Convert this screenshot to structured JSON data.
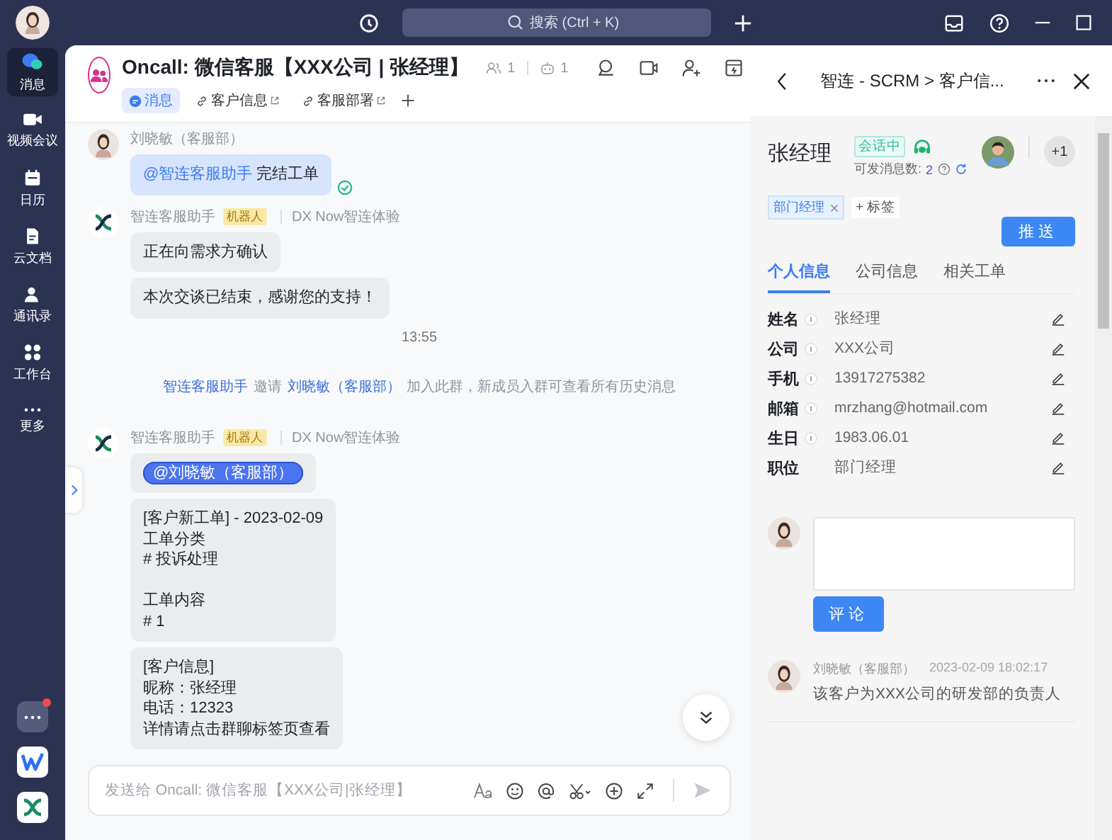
{
  "top_bar": {
    "search": {
      "placeholder": "搜索 (Ctrl + K)"
    }
  },
  "sidebar": {
    "items": [
      {
        "label": "消息",
        "kind": "chat",
        "selected": true
      },
      {
        "label": "视频会议",
        "kind": "video",
        "selected": false
      },
      {
        "label": "日历",
        "kind": "calendar",
        "selected": false
      },
      {
        "label": "云文档",
        "kind": "docs",
        "selected": false
      },
      {
        "label": "通讯录",
        "kind": "contacts",
        "selected": false
      },
      {
        "label": "工作台",
        "kind": "apps",
        "selected": false
      },
      {
        "label": "更多",
        "kind": "more",
        "selected": false
      }
    ]
  },
  "chat": {
    "title": "Oncall: 微信客服【XXX公司 | 张经理】",
    "member_count": "1",
    "bot_count": "1",
    "tabs": [
      {
        "label": "消息",
        "kind": "messages",
        "selected": true
      },
      {
        "label": "客户信息",
        "kind": "link",
        "selected": false
      },
      {
        "label": "客服部署",
        "kind": "link",
        "selected": false
      }
    ],
    "messages": [
      {
        "kind": "user",
        "sender": "刘晓敏（客服部）",
        "bubbles": [
          {
            "kind": "mention_text",
            "mention": "@智连客服助手",
            "text": "完结工单"
          }
        ]
      },
      {
        "kind": "bot",
        "sender": "智连客服助手",
        "badge": "机器人",
        "org": "DX Now智连体验",
        "bubbles": [
          {
            "kind": "text",
            "paragraphs": [
              [
                "正在向需求方确认"
              ]
            ]
          },
          {
            "kind": "text",
            "paragraphs": [
              [
                "本次交谈已结束，感谢您的支持！"
              ]
            ]
          }
        ]
      },
      {
        "kind": "time",
        "text": "13:55"
      },
      {
        "kind": "system",
        "parts": [
          {
            "text": "智连客服助手",
            "link": true
          },
          {
            "text": "邀请",
            "link": false
          },
          {
            "text": "刘晓敏（客服部）",
            "link": true
          },
          {
            "text": "加入此群，新成员入群可查看所有历史消息",
            "link": false
          }
        ]
      },
      {
        "kind": "bot",
        "sender": "智连客服助手",
        "badge": "机器人",
        "org": "DX Now智连体验",
        "bubbles": [
          {
            "kind": "mention",
            "mention": "@刘晓敏（客服部）"
          },
          {
            "kind": "text",
            "paragraphs": [
              [
                "[客户新工单] - 2023-02-09",
                "工单分类",
                "# 投诉处理"
              ],
              [
                "工单内容",
                "# 1"
              ]
            ]
          },
          {
            "kind": "text",
            "paragraphs": [
              [
                "[客户信息]",
                "昵称：张经理",
                "电话：12323",
                "详情请点击群聊标签页查看"
              ]
            ]
          }
        ]
      }
    ],
    "composer": {
      "placeholder": "发送给 Oncall: 微信客服【XXX公司|张经理】"
    }
  },
  "side_panel": {
    "title": "智连 - SCRM > 客户信...",
    "customer": {
      "name": "张经理",
      "status": "会话中",
      "quota_label": "可发消息数:",
      "quota_value": "2",
      "others": "+1"
    },
    "tags": [
      {
        "label": "部门经理"
      }
    ],
    "add_tag": "+ 标签",
    "push_button": "推送",
    "tabs": [
      {
        "label": "个人信息",
        "selected": true
      },
      {
        "label": "公司信息",
        "selected": false
      },
      {
        "label": "相关工单",
        "selected": false
      }
    ],
    "fields": [
      {
        "label": "姓名",
        "value": "张经理",
        "info": true
      },
      {
        "label": "公司",
        "value": "XXX公司",
        "info": true
      },
      {
        "label": "手机",
        "value": "13917275382",
        "info": true
      },
      {
        "label": "邮箱",
        "value": "mrzhang@hotmail.com",
        "info": true
      },
      {
        "label": "生日",
        "value": "1983.06.01",
        "info": true
      },
      {
        "label": "职位",
        "value": "部门经理",
        "info": false
      }
    ],
    "comment_button": "评论",
    "comments": [
      {
        "author": "刘晓敏（客服部）",
        "time": "2023-02-09 18:02:17",
        "text": "该客户为XXX公司的研发部的负责人"
      }
    ]
  }
}
